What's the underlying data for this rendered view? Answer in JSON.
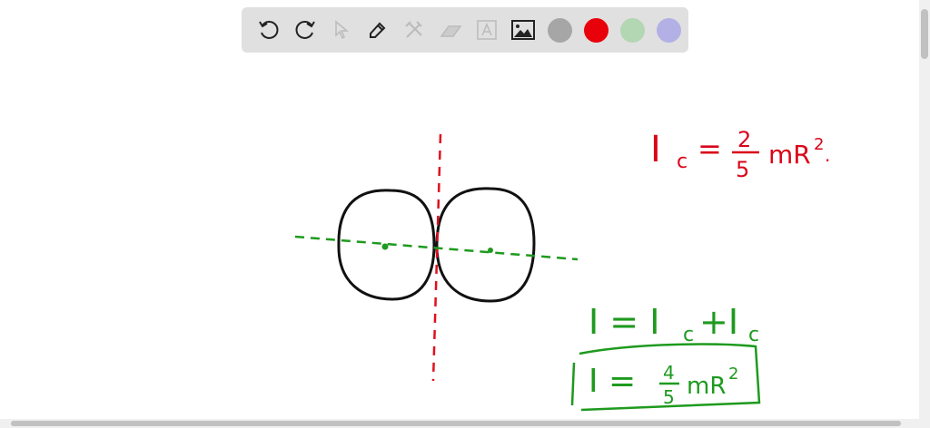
{
  "toolbar": {
    "tools": [
      "undo-icon",
      "redo-icon",
      "select-icon",
      "pen-icon",
      "tools-icon",
      "eraser-icon",
      "text-icon",
      "image-icon"
    ],
    "colors": [
      "#a6a6a6",
      "#e8000b",
      "#b3d6b3",
      "#b3b0e6"
    ]
  },
  "equations": {
    "eq1": {
      "lhs": "I",
      "sub": "c",
      "eq": "=",
      "num": "2",
      "den": "5",
      "rest": "mR",
      "sup": "2",
      "dot": ".",
      "color": "#d9061a"
    },
    "eq2": {
      "text": "I = I",
      "sub1": "c",
      "plus": "+I",
      "sub2": "c",
      "color": "#1e9a1e"
    },
    "eq3": {
      "lhs": "I =",
      "num": "4",
      "den": "5",
      "rest": "mR",
      "sup": "2",
      "color": "#1e9a1e"
    }
  }
}
